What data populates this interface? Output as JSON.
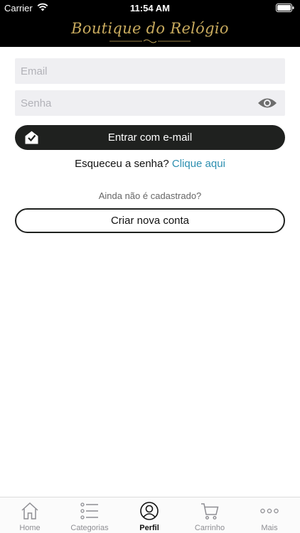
{
  "status_bar": {
    "carrier": "Carrier",
    "time": "11:54 AM"
  },
  "brand": {
    "name": "Boutique do Relógio"
  },
  "login_form": {
    "email_placeholder": "Email",
    "password_placeholder": "Senha",
    "login_button_label": "Entrar com e-mail",
    "forgot_prompt": "Esqueceu a senha?",
    "forgot_link": "Clique aqui"
  },
  "register": {
    "hint": "Ainda não é cadastrado?",
    "button_label": "Criar nova conta"
  },
  "tab_bar": {
    "items": [
      {
        "label": "Home",
        "icon": "home-icon"
      },
      {
        "label": "Categorias",
        "icon": "list-icon"
      },
      {
        "label": "Perfil",
        "icon": "profile-icon",
        "active": true
      },
      {
        "label": "Carrinho",
        "icon": "cart-icon"
      },
      {
        "label": "Mais",
        "icon": "more-icon"
      }
    ]
  },
  "colors": {
    "header_bg": "#000000",
    "brand_gold": "#c9ab5e",
    "button_dark": "#1f211f",
    "link": "#2d8fb0",
    "field_bg": "#efeff2"
  }
}
